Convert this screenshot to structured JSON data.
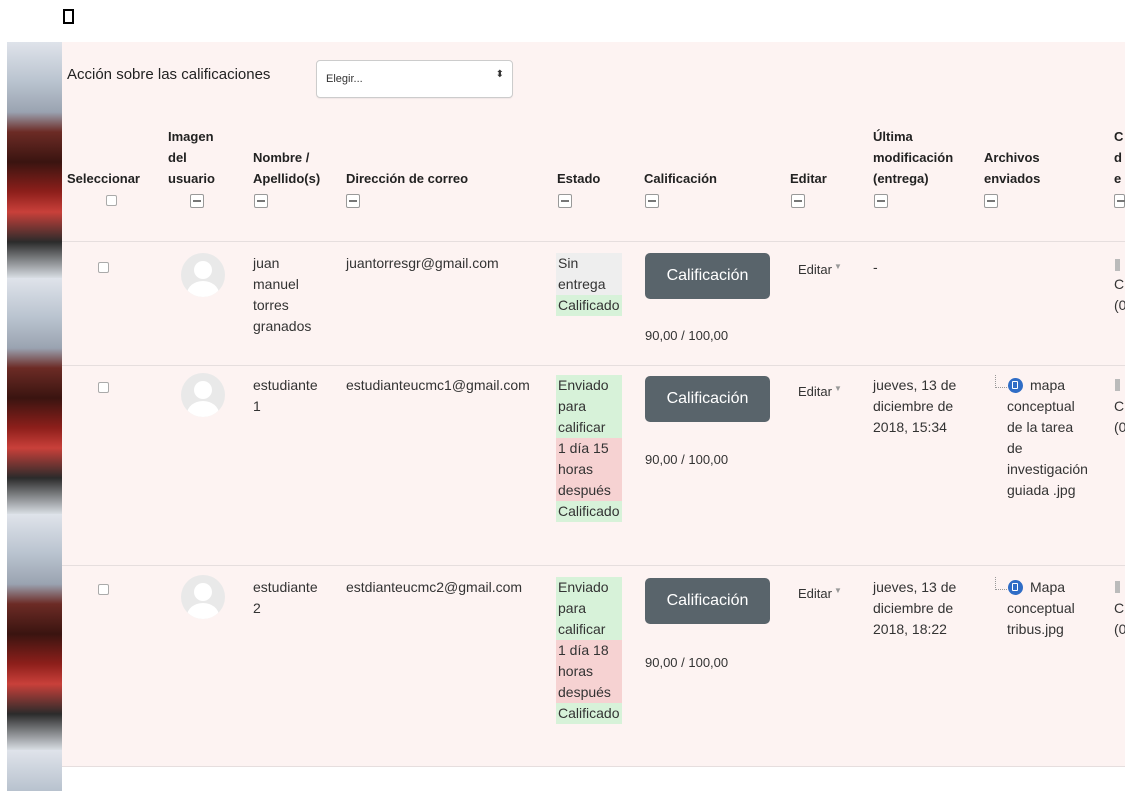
{
  "toolbar": {
    "action_label": "Acción sobre las calificaciones",
    "select_value": "Elegir...",
    "select_arrow": "⬍"
  },
  "columns": {
    "select": "Seleccionar",
    "image": [
      "Imagen",
      "del",
      "usuario"
    ],
    "name": [
      "Nombre /",
      "Apellido(s)"
    ],
    "email": "Dirección de correo",
    "status": "Estado",
    "grade": "Calificación",
    "edit": "Editar",
    "last_modified": [
      "Última",
      "modificación",
      "(entrega)"
    ],
    "files": [
      "Archivos",
      "enviados"
    ],
    "cut": [
      "C",
      "d",
      "e"
    ]
  },
  "rows": [
    {
      "name": [
        "juan",
        "manuel",
        "torres",
        "granados"
      ],
      "email": "juantorresgr@gmail.com",
      "status": [
        {
          "text": "Sin",
          "tone": "gray"
        },
        {
          "text": "entrega",
          "tone": "gray"
        },
        {
          "text": "Calificado",
          "tone": "green"
        }
      ],
      "grade_button": "Calificación",
      "grade": "90,00 / 100,00",
      "edit": "Editar",
      "last_modified": [
        "-"
      ],
      "files": [],
      "cut": [
        "C",
        "(0"
      ]
    },
    {
      "name": [
        "estudiante",
        "1"
      ],
      "email": "estudianteucmc1@gmail.com",
      "status": [
        {
          "text": "Enviado",
          "tone": "green"
        },
        {
          "text": "para",
          "tone": "green"
        },
        {
          "text": "calificar",
          "tone": "green"
        },
        {
          "text": "1 día 15",
          "tone": "red"
        },
        {
          "text": "horas",
          "tone": "red"
        },
        {
          "text": "después",
          "tone": "red"
        },
        {
          "text": "Calificado",
          "tone": "green"
        }
      ],
      "grade_button": "Calificación",
      "grade": "90,00 / 100,00",
      "edit": "Editar",
      "last_modified": [
        "jueves, 13 de",
        "diciembre de",
        "2018, 15:34"
      ],
      "files": [
        "mapa",
        "conceptual",
        "de la tarea",
        "de",
        "investigación",
        "guiada .jpg"
      ],
      "cut": [
        "C",
        "(0"
      ]
    },
    {
      "name": [
        "estudiante",
        "2"
      ],
      "email": "estdianteucmc2@gmail.com",
      "status": [
        {
          "text": "Enviado",
          "tone": "green"
        },
        {
          "text": "para",
          "tone": "green"
        },
        {
          "text": "calificar",
          "tone": "green"
        },
        {
          "text": "1 día 18",
          "tone": "red"
        },
        {
          "text": "horas",
          "tone": "red"
        },
        {
          "text": "después",
          "tone": "red"
        },
        {
          "text": "Calificado",
          "tone": "green"
        }
      ],
      "grade_button": "Calificación",
      "grade": "90,00 / 100,00",
      "edit": "Editar",
      "last_modified": [
        "jueves, 13 de",
        "diciembre de",
        "2018, 18:22"
      ],
      "files": [
        "Mapa",
        "conceptual",
        "tribus.jpg"
      ],
      "cut": [
        "C",
        "(0"
      ]
    }
  ],
  "icons": {
    "edit_caret": "▼",
    "file_icon": "file-icon",
    "collapse_icon": "collapse-column-icon"
  },
  "colors": {
    "panel_bg": "#fdf3f2",
    "button_bg": "#59646b",
    "status_green": "#d7f2d9",
    "status_red": "#f6d2d2",
    "status_gray": "#eeeeee"
  }
}
